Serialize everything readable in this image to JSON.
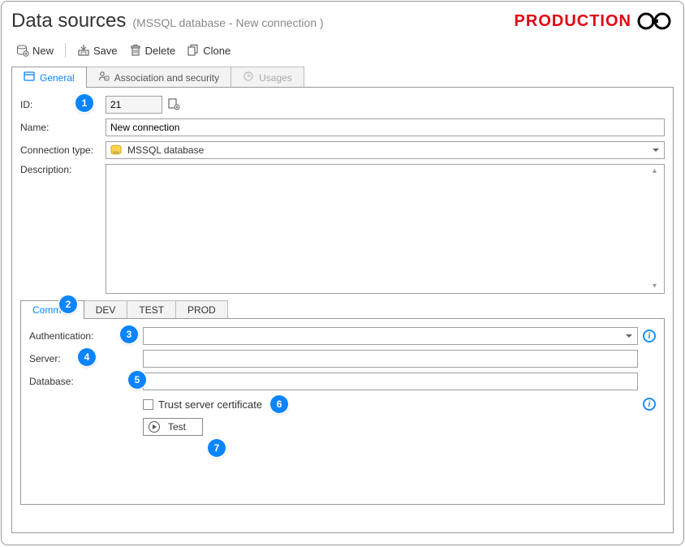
{
  "header": {
    "title": "Data sources",
    "subtitle": "(MSSQL database - New connection )",
    "env_label": "PRODUCTION"
  },
  "toolbar": {
    "new_label": "New",
    "save_label": "Save",
    "delete_label": "Delete",
    "clone_label": "Clone"
  },
  "tabs": {
    "general": "General",
    "association": "Association and security",
    "usages": "Usages"
  },
  "form": {
    "id_label": "ID:",
    "id_value": "21",
    "name_label": "Name:",
    "name_value": "New connection",
    "conn_type_label": "Connection type:",
    "conn_type_value": "MSSQL database",
    "description_label": "Description:",
    "description_value": ""
  },
  "sub_tabs": [
    "Common",
    "DEV",
    "TEST",
    "PROD"
  ],
  "sub_form": {
    "auth_label": "Authentication:",
    "auth_value": "",
    "server_label": "Server:",
    "server_value": "",
    "database_label": "Database:",
    "database_value": "",
    "trust_label": "Trust server certificate",
    "test_label": "Test"
  },
  "markers": [
    "1",
    "2",
    "3",
    "4",
    "5",
    "6",
    "7"
  ]
}
